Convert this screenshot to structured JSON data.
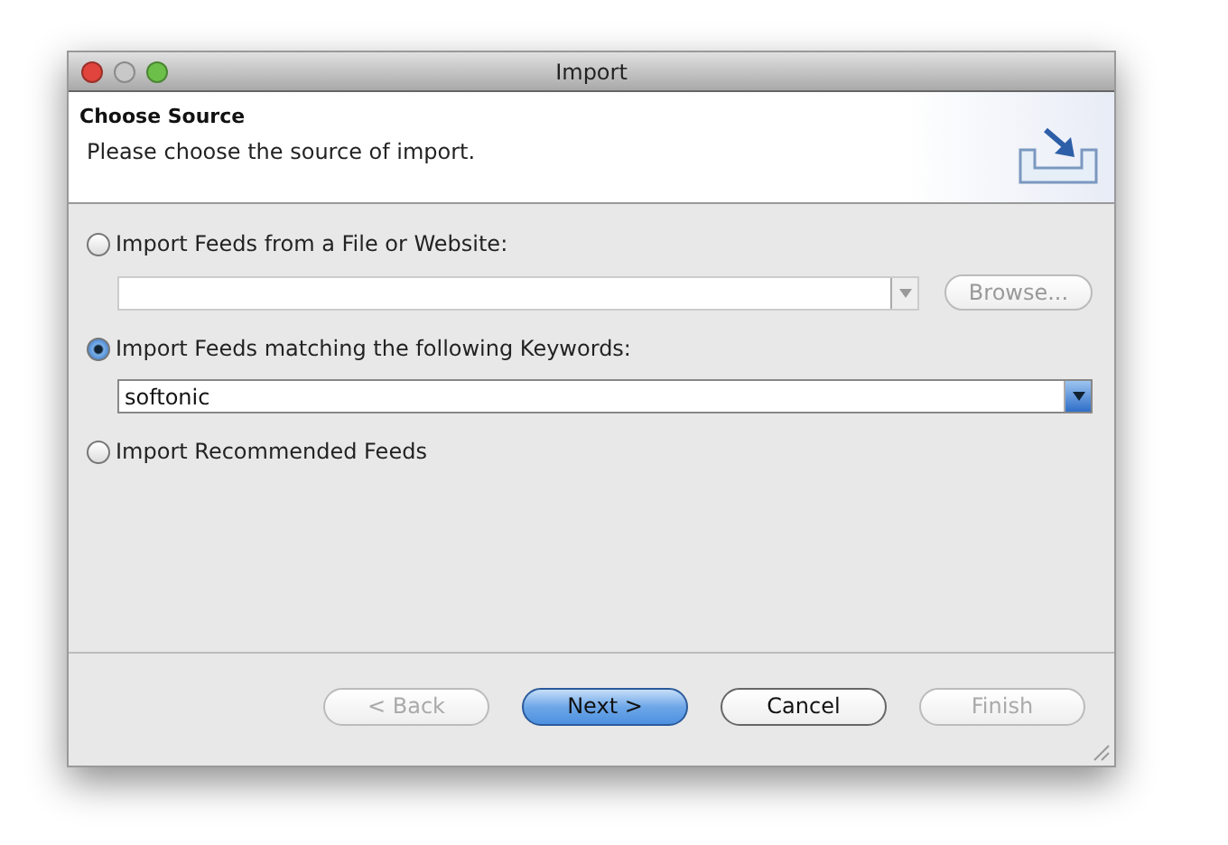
{
  "window": {
    "title": "Import"
  },
  "header": {
    "title": "Choose Source",
    "description": "Please choose the source of import."
  },
  "options": [
    {
      "label": "Import Feeds from a File or Website:",
      "selected": false,
      "kind": "file",
      "field": {
        "disabled": true
      },
      "browse": {
        "label": "Browse...",
        "disabled": true
      }
    },
    {
      "label": "Import Feeds matching the following Keywords:",
      "selected": true,
      "kind": "keywords",
      "field": {
        "value": "softonic",
        "disabled": false
      }
    },
    {
      "label": "Import Recommended Feeds",
      "selected": false,
      "kind": "plain"
    }
  ],
  "buttons": [
    {
      "label": "< Back",
      "disabled": true,
      "default": false
    },
    {
      "label": "Next >",
      "disabled": false,
      "default": true
    },
    {
      "label": "Cancel",
      "disabled": false,
      "default": false
    },
    {
      "label": "Finish",
      "disabled": true,
      "default": false
    }
  ]
}
